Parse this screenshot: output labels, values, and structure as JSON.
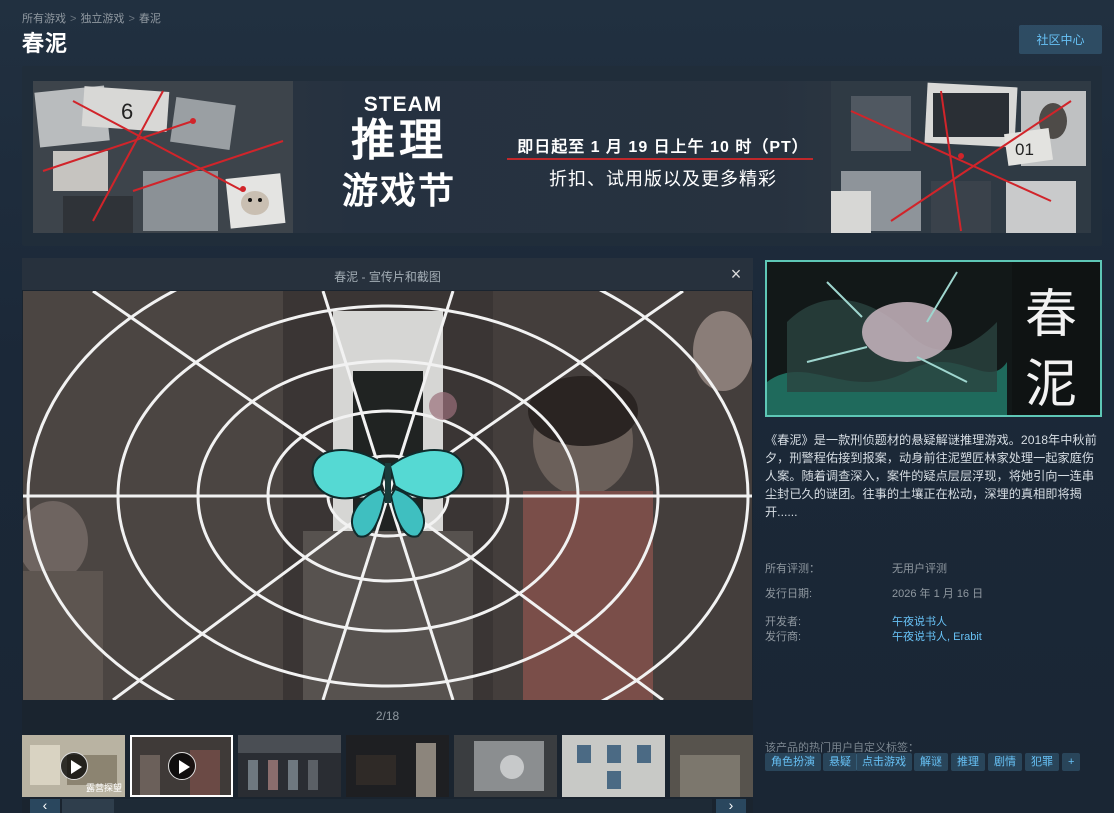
{
  "breadcrumb": {
    "items": [
      "所有游戏",
      "独立游戏",
      "春泥"
    ],
    "separator": ">"
  },
  "page": {
    "title": "春泥",
    "community_button": "社区中心"
  },
  "banner": {
    "steam": "STEAM",
    "line1": "推理",
    "line2": "游戏节",
    "date_text": "即日起至 1 月 19 日上午 10 时（PT）",
    "subtitle": "折扣、试用版以及更多精彩",
    "collage_left_note": "6",
    "collage_right_note": "01"
  },
  "media": {
    "title": "春泥 - 宣传片和截图",
    "close_icon": "×",
    "counter": "2/18",
    "thumbnail_overlay": "露营探望",
    "scroll_left": "‹",
    "scroll_right": "›"
  },
  "capsule": {
    "logo_line1": "春",
    "logo_line2": "泥"
  },
  "description": "《春泥》是一款刑侦题材的悬疑解谜推理游戏。2018年中秋前夕，刑警程佑接到报案，动身前往泥塑匠林家处理一起家庭伤人案。随着调查深入，案件的疑点层层浮现，将她引向一连串尘封已久的谜团。往事的土壤正在松动，深埋的真相即将揭开......",
  "details": {
    "reviews_label": "所有评测：",
    "reviews_value": "无用户评测",
    "release_label": "发行日期:",
    "release_value": "2026 年 1 月 16 日",
    "developer_label": "开发者:",
    "developer_value": "午夜说书人",
    "publisher_label": "发行商:",
    "publisher_value_1": "午夜说书人",
    "publisher_sep": ", ",
    "publisher_value_2": "Erabit"
  },
  "tags": {
    "label": "该产品的热门用户自定义标签：",
    "items": [
      "角色扮演",
      "悬疑",
      "点击游戏",
      "解谜",
      "推理",
      "剧情",
      "犯罪",
      "+"
    ]
  },
  "colors": {
    "background": "#1b2838",
    "accent": "#67c1f5",
    "capsule_border": "#5ec7b6",
    "banner_red": "#c0282b"
  }
}
